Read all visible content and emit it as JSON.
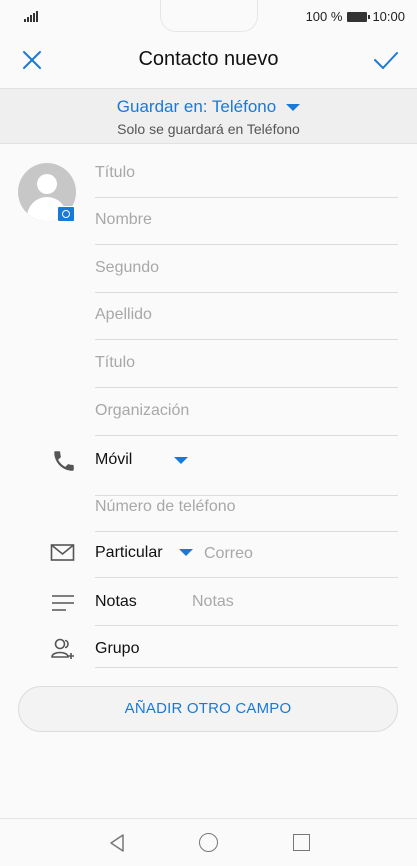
{
  "status": {
    "battery_percent": "100 %",
    "time": "10:00"
  },
  "header": {
    "title": "Contacto nuevo",
    "close_icon": "close-icon",
    "confirm_icon": "check-icon"
  },
  "save_location": {
    "label": "Guardar en: Teléfono",
    "subtitle": "Solo se guardará en Teléfono"
  },
  "fields": {
    "title_prefix": "Título",
    "first_name": "Nombre",
    "middle_name": "Segundo",
    "last_name": "Apellido",
    "job_title": "Título",
    "organization": "Organización"
  },
  "phone": {
    "type_label": "Móvil",
    "placeholder": "Número de teléfono"
  },
  "email": {
    "type_label": "Particular",
    "placeholder": "Correo"
  },
  "notes": {
    "label": "Notas",
    "placeholder": "Notas"
  },
  "group": {
    "label": "Grupo"
  },
  "add_field_button": "AÑADIR OTRO CAMPO",
  "colors": {
    "accent": "#1a79d6",
    "background": "#fafafa"
  }
}
